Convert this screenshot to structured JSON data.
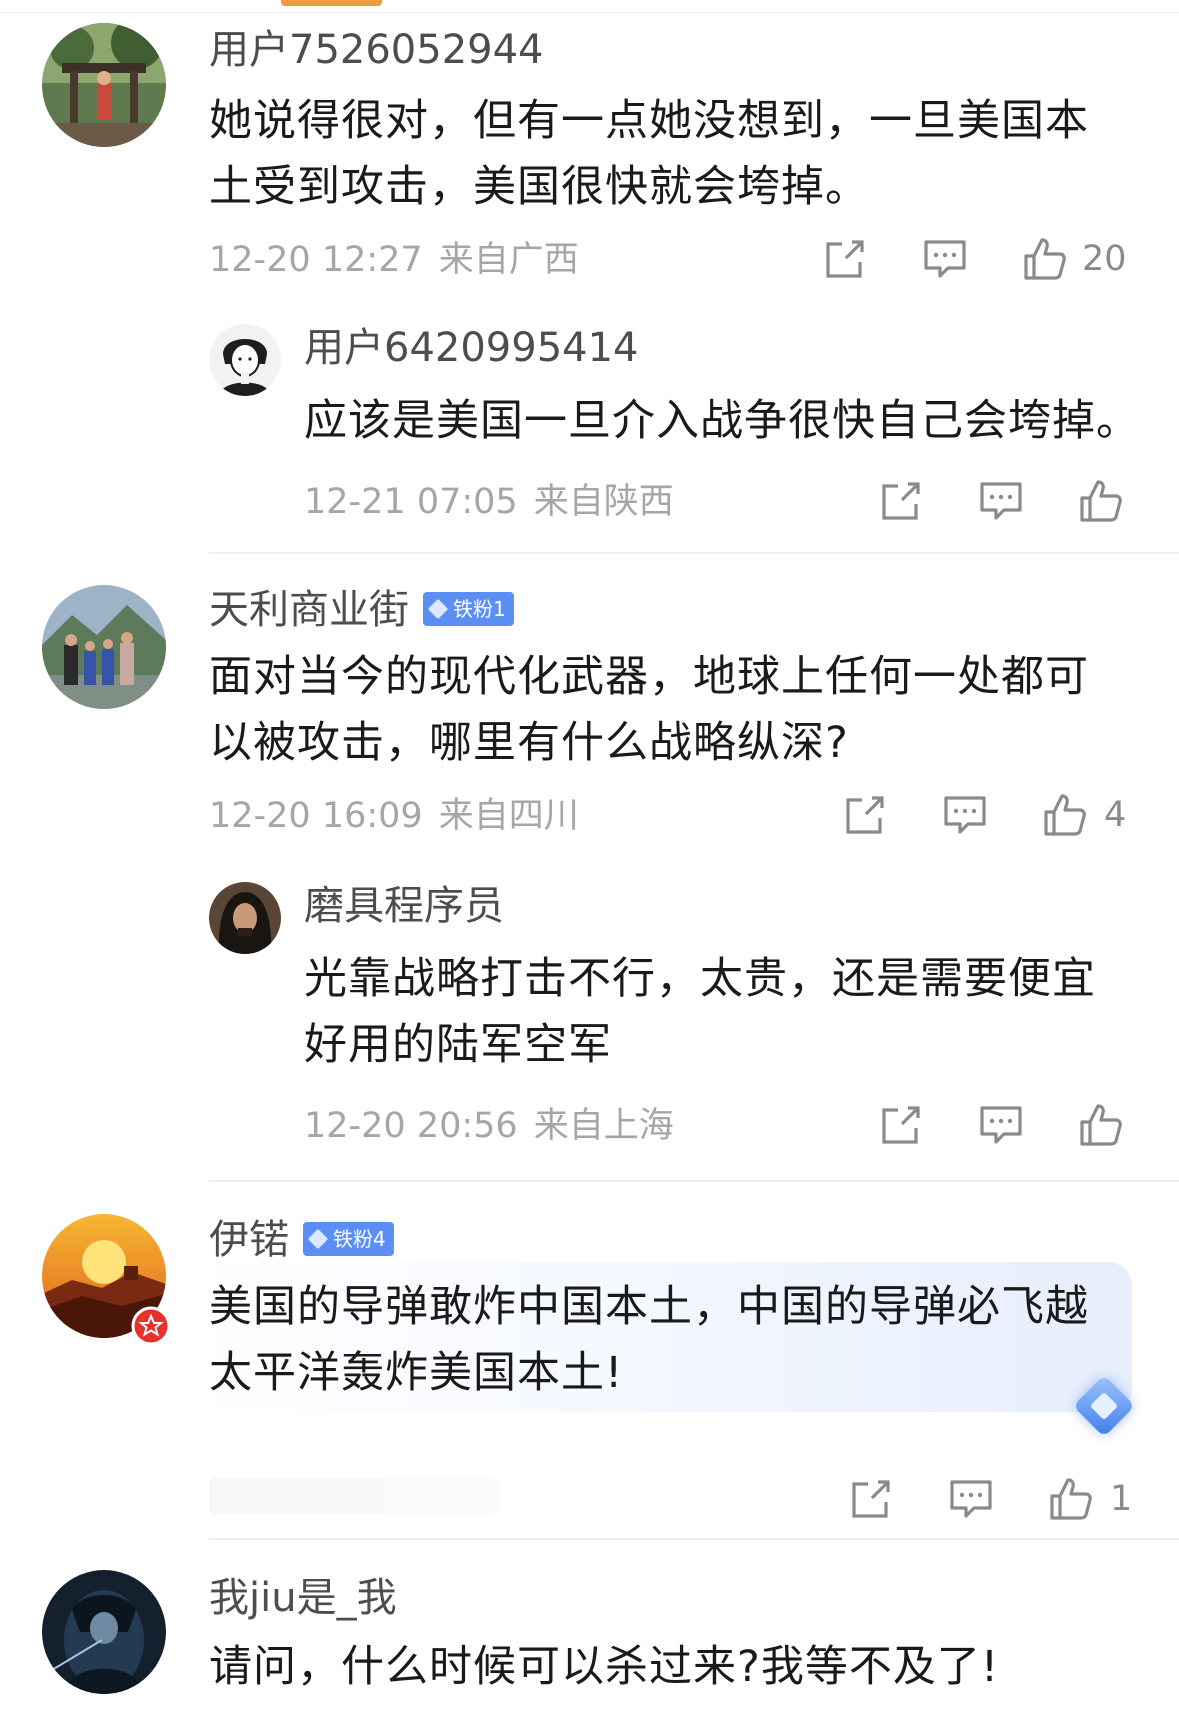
{
  "comments": [
    {
      "username": "用户7526052944",
      "text": "她说得很对，但有一点她没想到，一旦美国本土受到攻击，美国很快就会垮掉。",
      "time": "12-20 12:27",
      "region": "来自广西",
      "likes": "20",
      "avatar_icon": "avatar-photo-pavilion",
      "reply": {
        "username": "用户6420995414",
        "text": "应该是美国一旦介入战争很快自己会垮掉。",
        "time": "12-21 07:05",
        "region": "来自陕西",
        "likes": "",
        "avatar_icon": "avatar-cartoon-figure"
      }
    },
    {
      "username": "天利商业街",
      "badge": "铁粉1",
      "text": "面对当今的现代化武器，地球上任何一处都可以被攻击，哪里有什么战略纵深?",
      "time": "12-20 16:09",
      "region": "来自四川",
      "likes": "4",
      "avatar_icon": "avatar-photo-family",
      "reply": {
        "username": "磨具程序员",
        "text": "光靠战略打击不行，太贵，还是需要便宜好用的陆军空军",
        "time": "12-20 20:56",
        "region": "来自上海",
        "likes": "",
        "avatar_icon": "avatar-photo-longhair"
      }
    },
    {
      "username": "伊锘",
      "badge": "铁粉4",
      "text": "美国的导弹敢炸中国本土，中国的导弹必飞越太平洋轰炸美国本土!",
      "likes": "1",
      "avatar_icon": "avatar-great-wall"
    },
    {
      "username": "我jiu是_我",
      "text": "请问，什么时候可以杀过来?我等不及了!",
      "avatar_icon": "avatar-dark-figure"
    }
  ],
  "colors": {
    "text_main": "#1a1a1a",
    "username": "#4d4d4d",
    "meta": "#a6a6a6",
    "badge": "#5b8ff6",
    "icon": "#8a8a8a",
    "divider": "#efefef",
    "accent_tab": "#f29a3c"
  }
}
